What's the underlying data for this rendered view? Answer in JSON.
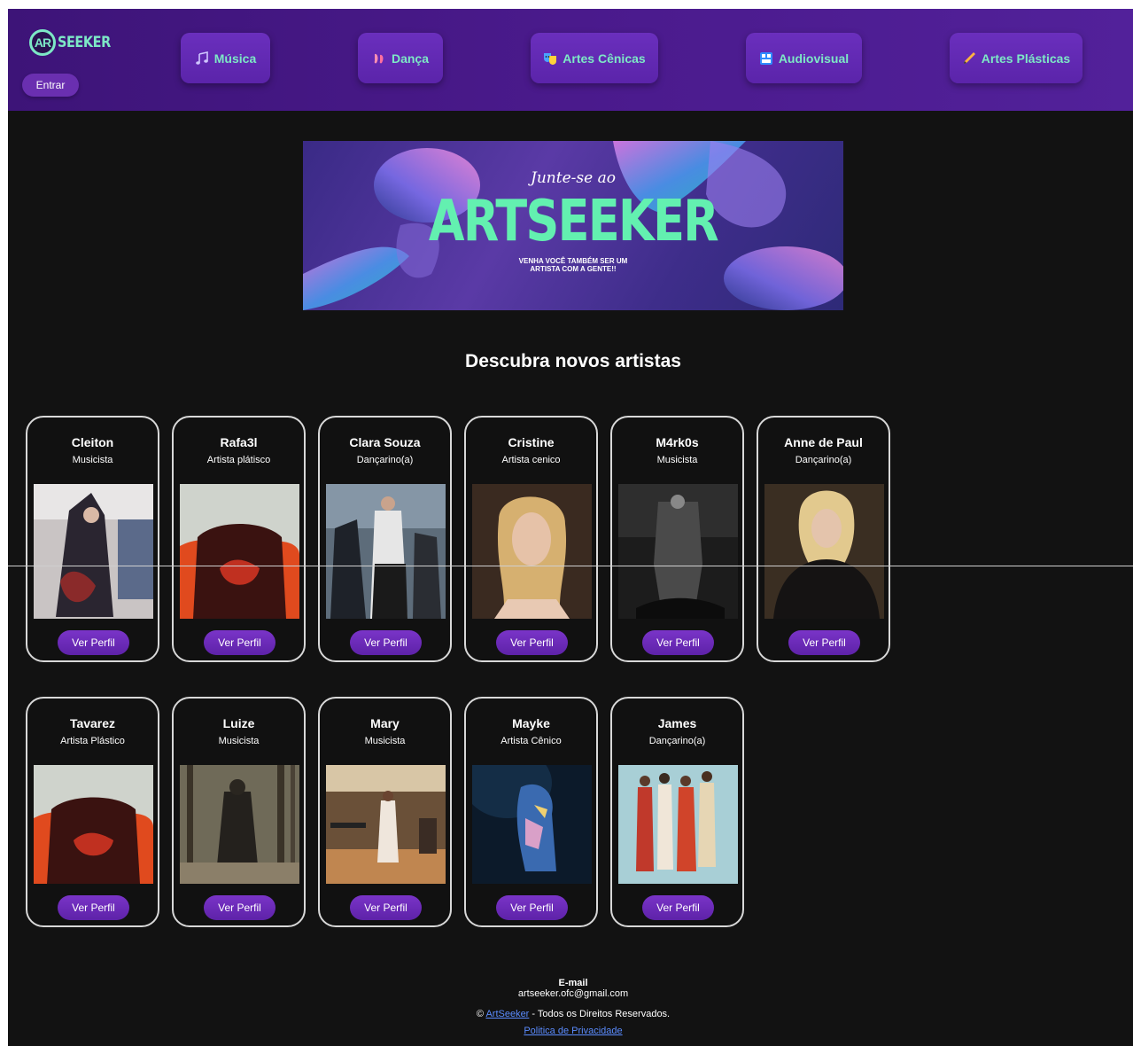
{
  "header": {
    "logo_text": "SEEKER",
    "logo_mark": "AR",
    "login_label": "Entrar",
    "nav": [
      {
        "label": "Música",
        "icon": "music-notes-icon"
      },
      {
        "label": "Dança",
        "icon": "ballet-shoes-icon"
      },
      {
        "label": "Artes Cênicas",
        "icon": "theater-masks-icon"
      },
      {
        "label": "Audiovisual",
        "icon": "film-frames-icon"
      },
      {
        "label": "Artes Plásticas",
        "icon": "pencil-icon"
      }
    ]
  },
  "banner": {
    "subtitle": "Junte-se ao",
    "title": "ARTSEEKER",
    "cta_line1": "VENHA VOCÊ TAMBÉM SER UM",
    "cta_line2": "ARTISTA COM A GENTE!!"
  },
  "section_title": "Descubra novos artistas",
  "artists": [
    {
      "name": "Cleiton",
      "role": "Musicista",
      "button": "Ver Perfil"
    },
    {
      "name": "Rafa3l",
      "role": "Artista plátisco",
      "button": "Ver Perfil"
    },
    {
      "name": "Clara Souza",
      "role": "Dançarino(a)",
      "button": "Ver Perfil"
    },
    {
      "name": "Cristine",
      "role": "Artista cenico",
      "button": "Ver Perfil"
    },
    {
      "name": "M4rk0s",
      "role": "Musicista",
      "button": "Ver Perfil"
    },
    {
      "name": "Anne de Paul",
      "role": "Dançarino(a)",
      "button": "Ver Perfil"
    },
    {
      "name": "Tavarez",
      "role": "Artista Plástico",
      "button": "Ver Perfil"
    },
    {
      "name": "Luize",
      "role": "Musicista",
      "button": "Ver Perfil"
    },
    {
      "name": "Mary",
      "role": "Musicista",
      "button": "Ver Perfil"
    },
    {
      "name": "Mayke",
      "role": "Artista Cênico",
      "button": "Ver Perfil"
    },
    {
      "name": "James",
      "role": "Dançarino(a)",
      "button": "Ver Perfil"
    }
  ],
  "footer": {
    "email_label": "E-mail",
    "email": "artseeker.ofc@gmail.com",
    "copyright_symbol": "©",
    "brand_link": "ArtSeeker",
    "rights": " - Todos os Direitos Reservados.",
    "privacy_link": "Politica de Privacidade"
  },
  "colors": {
    "header_bg": "#4a1a8c",
    "accent_green": "#7de8c6",
    "button_purple": "#6a2fb0",
    "page_bg": "#121212"
  }
}
